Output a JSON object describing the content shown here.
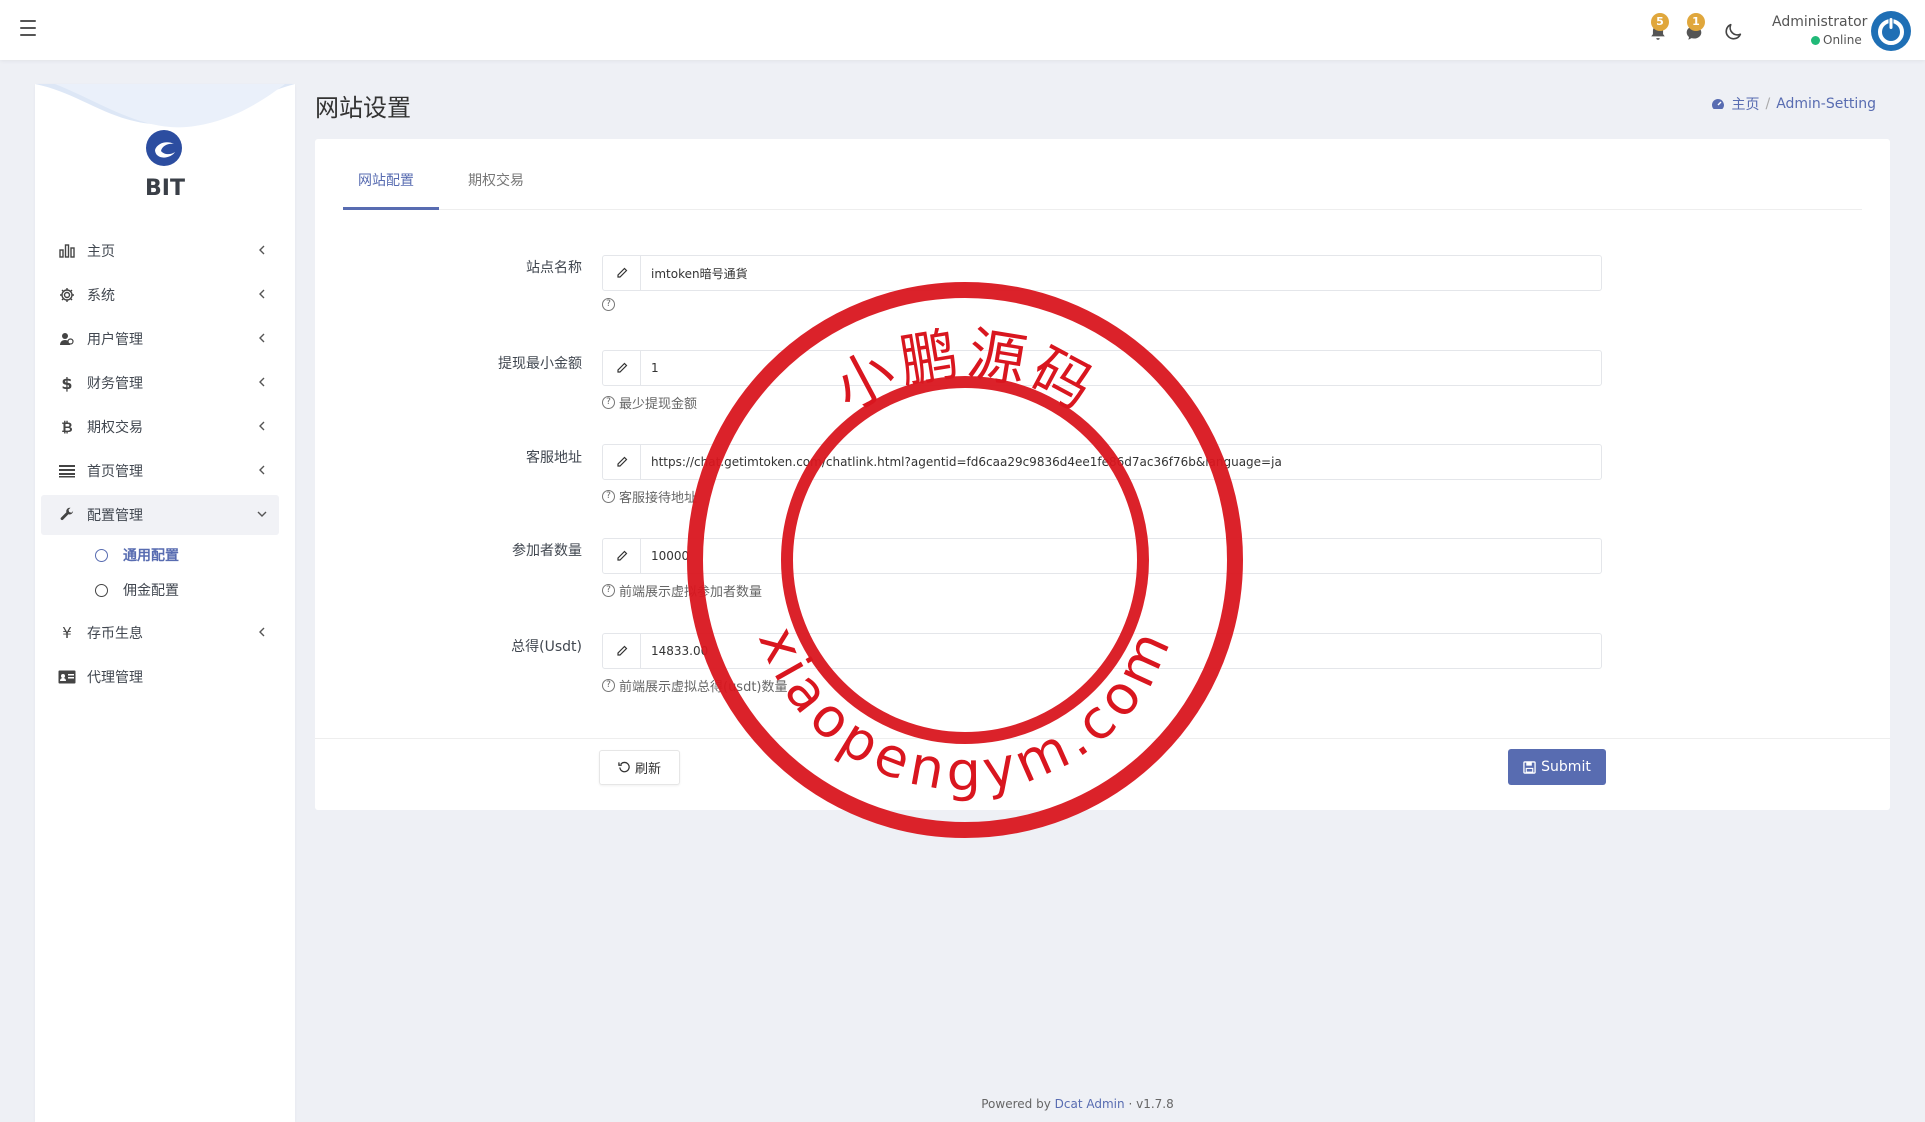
{
  "topbar": {
    "notifications": [
      {
        "icon": "bell-icon",
        "count": "5"
      },
      {
        "icon": "chat-icon",
        "count": "1"
      }
    ],
    "user": {
      "name": "Administrator",
      "status": "Online"
    }
  },
  "sidebar": {
    "brand": "BIT",
    "items": [
      {
        "label": "主页",
        "icon": "bar-chart-icon"
      },
      {
        "label": "系统",
        "icon": "gear-icon"
      },
      {
        "label": "用户管理",
        "icon": "users-icon"
      },
      {
        "label": "财务管理",
        "icon": "dollar-icon"
      },
      {
        "label": "期权交易",
        "icon": "bitcoin-icon"
      },
      {
        "label": "首页管理",
        "icon": "list-icon"
      },
      {
        "label": "配置管理",
        "icon": "wrench-icon"
      },
      {
        "label": "存币生息",
        "icon": "yen-icon"
      },
      {
        "label": "代理管理",
        "icon": "id-card-icon"
      }
    ],
    "subitems": [
      {
        "label": "通用配置"
      },
      {
        "label": "佣金配置"
      }
    ]
  },
  "page": {
    "title": "网站设置",
    "breadcrumb": {
      "home": "主页",
      "sep": "/",
      "current": "Admin-Setting"
    }
  },
  "tabs": [
    {
      "label": "网站配置"
    },
    {
      "label": "期权交易"
    }
  ],
  "form": {
    "fields": [
      {
        "label": "站点名称",
        "value": "imtoken暗号通貨",
        "help": ""
      },
      {
        "label": "提现最小金额",
        "value": "1",
        "help": "最少提现金额"
      },
      {
        "label": "客服地址",
        "value": "https://chat.getimtoken.com/chatlink.html?agentid=fd6caa29c9836d4ee1fe86d7ac36f76b&language=ja",
        "help": "客服接待地址"
      },
      {
        "label": "参加者数量",
        "value": "10000",
        "help": "前端展示虚拟参加者数量"
      },
      {
        "label": "总得(Usdt)",
        "value": "14833.00",
        "help": "前端展示虚拟总得(usdt)数量"
      }
    ],
    "refresh_label": "刷新",
    "submit_label": "Submit"
  },
  "watermark": {
    "top_text": "小鹏源码",
    "bottom_text": "xiaopengym.com",
    "color": "#d9161f"
  },
  "footer": {
    "prefix": "Powered by",
    "link": "Dcat Admin",
    "sep": "·",
    "version": "v1.7.8"
  },
  "colors": {
    "primary": "#586cb1",
    "badge": "#e0a73c",
    "online": "#21b978"
  }
}
